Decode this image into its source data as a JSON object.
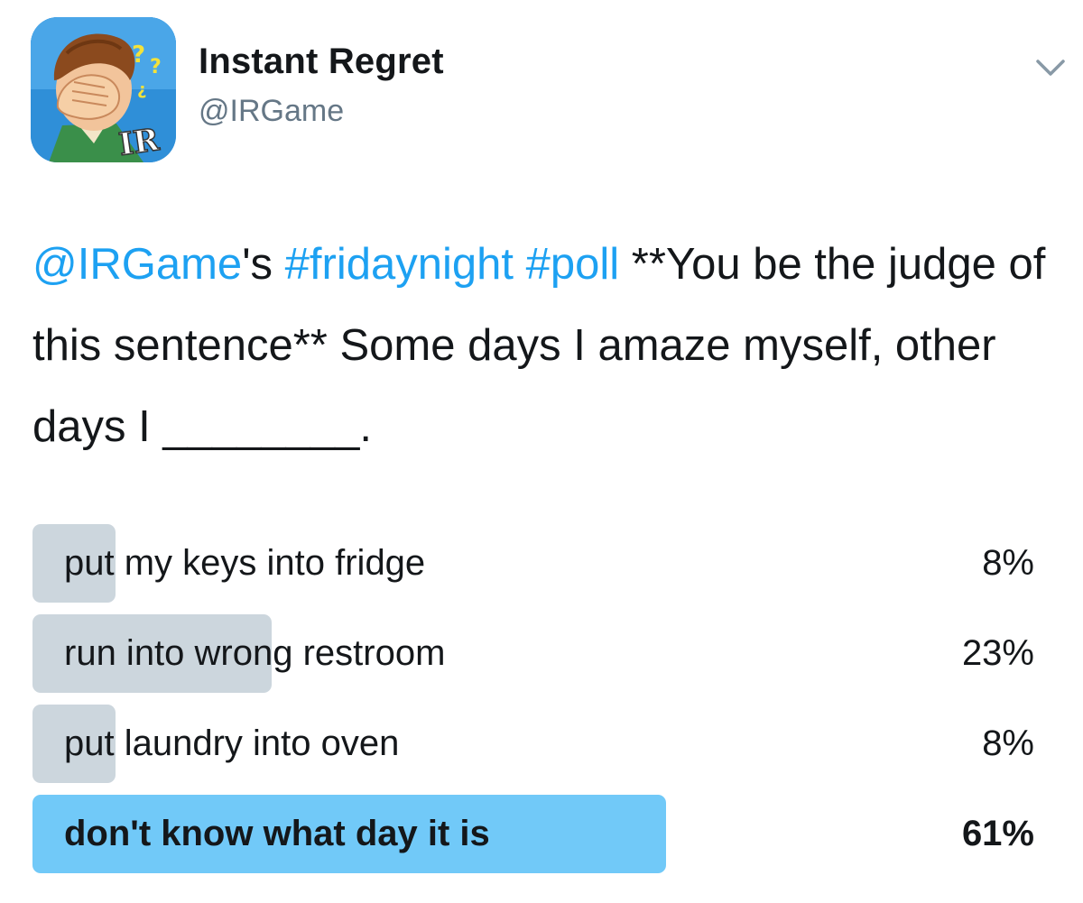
{
  "author": {
    "display_name": "Instant Regret",
    "handle": "@IRGame",
    "avatar_text": "IR",
    "avatar_icon": "facepalm-cartoon-icon"
  },
  "menu": {
    "icon": "chevron-down-icon"
  },
  "tweet": {
    "mention": "@IRGame",
    "text_after_mention": "'s ",
    "hashtag_1": "#fridaynight",
    "space": " ",
    "hashtag_2": "#poll",
    "body": " **You be the judge of this sentence** Some days I amaze myself, other days I ________."
  },
  "poll": {
    "options": [
      {
        "label": "put my keys into fridge",
        "percent_text": "8%",
        "percent": 8,
        "winner": false
      },
      {
        "label": "run into wrong restroom",
        "percent_text": "23%",
        "percent": 23,
        "winner": false
      },
      {
        "label": "put laundry into oven",
        "percent_text": "8%",
        "percent": 8,
        "winner": false
      },
      {
        "label": "don't know what day it is",
        "percent_text": "61%",
        "percent": 61,
        "winner": true
      }
    ]
  },
  "colors": {
    "link": "#1da1f2",
    "bar_default": "#ccd6dd",
    "bar_winner": "#71c9f8",
    "handle_gray": "#657786"
  }
}
